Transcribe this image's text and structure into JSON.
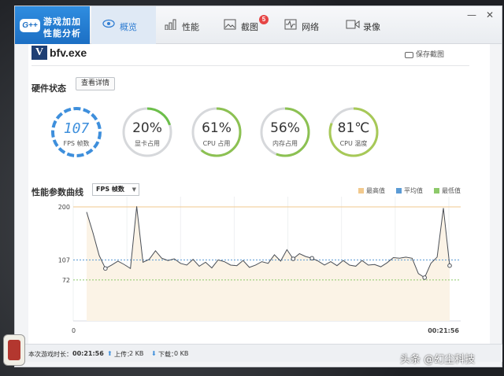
{
  "window": {
    "brand_line1": "游戏加加",
    "brand_line2": "性能分析",
    "brand_badge": "G++",
    "tabs": [
      {
        "label": "概览",
        "icon": "eye-icon",
        "active": true
      },
      {
        "label": "性能",
        "icon": "bar-chart-icon",
        "active": false
      },
      {
        "label": "截图",
        "icon": "image-icon",
        "active": false,
        "badge": "5"
      },
      {
        "label": "网络",
        "icon": "pulse-icon",
        "active": false
      },
      {
        "label": "录像",
        "icon": "video-icon",
        "active": false
      }
    ],
    "controls": {
      "minimize": "—",
      "close": "✕"
    }
  },
  "app": {
    "logo_letter": "V",
    "name": "bfv.exe",
    "save_screenshot": "保存截图"
  },
  "hardware": {
    "title": "硬件状态",
    "details_button": "查看详情",
    "gauges": [
      {
        "value": "107",
        "label": "FPS 帧数",
        "percent": 100,
        "color": "#3e8fdc"
      },
      {
        "value": "20%",
        "label": "显卡占用",
        "percent": 20,
        "color": "#6cbf4a"
      },
      {
        "value": "61%",
        "label": "CPU 占用",
        "percent": 61,
        "color": "#8cc152"
      },
      {
        "value": "56%",
        "label": "内存占用",
        "percent": 56,
        "color": "#8cc152"
      },
      {
        "value": "81℃",
        "label": "CPU 温度",
        "percent": 81,
        "color": "#a7c957"
      }
    ]
  },
  "curve": {
    "title": "性能参数曲线",
    "metric_select": "FPS 帧数",
    "legend": [
      {
        "label": "最高值",
        "color": "#f2c98d"
      },
      {
        "label": "平均值",
        "color": "#5b9bd5"
      },
      {
        "label": "最低值",
        "color": "#8dc96a"
      }
    ]
  },
  "chart_data": {
    "type": "area",
    "y_ticks": [
      "200",
      "107",
      "72"
    ],
    "x_tick_start": "0",
    "x_tick_end": "00:21:56",
    "max": 200,
    "avg": 107,
    "min": 72,
    "ylim": [
      0,
      218
    ],
    "values": [
      191,
      155,
      115,
      92,
      98,
      105,
      99,
      92,
      201,
      103,
      108,
      123,
      110,
      106,
      109,
      101,
      98,
      108,
      96,
      103,
      93,
      107,
      104,
      98,
      97,
      106,
      94,
      98,
      104,
      101,
      116,
      105,
      125,
      109,
      118,
      113,
      110,
      105,
      98,
      104,
      97,
      106,
      98,
      96,
      106,
      98,
      99,
      95,
      102,
      111,
      110,
      112,
      110,
      83,
      76,
      101,
      112,
      198,
      97
    ],
    "markers": [
      3,
      33,
      36,
      54,
      58
    ]
  },
  "status": {
    "duration_label": "本次游戏时长：",
    "duration_value": "00:21:56",
    "upload_label": "上传：",
    "upload_value": "2 KB",
    "download_label": "下载：",
    "download_value": "0 KB"
  },
  "watermark": "头条 @幻尘科技"
}
